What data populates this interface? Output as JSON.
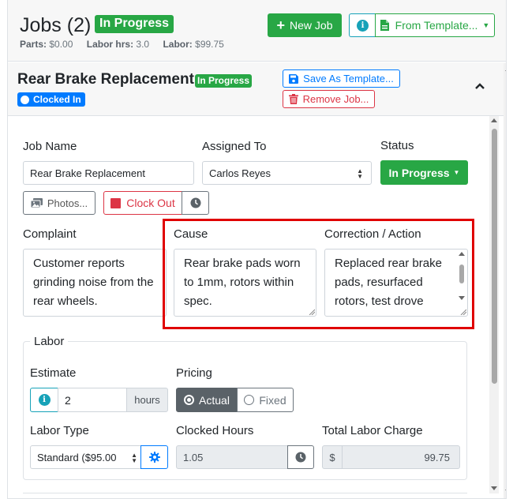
{
  "jobs_header": {
    "title": "Jobs (2)",
    "status_badge": "In Progress",
    "totals": [
      {
        "label": "Parts:",
        "value": "$0.00"
      },
      {
        "label": "Labor hrs:",
        "value": "3.0"
      },
      {
        "label": "Labor:",
        "value": "$99.75"
      }
    ],
    "new_job_label": "New Job",
    "from_template_label": "From Template..."
  },
  "job": {
    "title": "Rear Brake Replacement",
    "status_badge": "In Progress",
    "clocked_badge": "Clocked In",
    "save_template_label": "Save As Template...",
    "remove_job_label": "Remove Job..."
  },
  "form": {
    "job_name_label": "Job Name",
    "job_name_value": "Rear Brake Replacement",
    "assigned_to_label": "Assigned To",
    "assigned_to_value": "Carlos Reyes",
    "status_label": "Status",
    "status_value": "In Progress",
    "photos_label": "Photos...",
    "clock_out_label": "Clock Out",
    "complaint_label": "Complaint",
    "complaint_value": "Customer reports grinding noise from the rear wheels.",
    "cause_label": "Cause",
    "cause_value": "Rear brake pads worn to 1mm, rotors within spec.",
    "correction_label": "Correction / Action",
    "correction_value": "Replaced rear brake pads, resurfaced rotors, test drove"
  },
  "labor": {
    "legend": "Labor",
    "estimate_label": "Estimate",
    "estimate_value": "2",
    "estimate_unit": "hours",
    "pricing_label": "Pricing",
    "pricing_options": [
      "Actual",
      "Fixed"
    ],
    "pricing_selected": "Actual",
    "labor_type_label": "Labor Type",
    "labor_type_value": "Standard ($95.00",
    "clocked_hours_label": "Clocked Hours",
    "clocked_hours_value": "1.05",
    "total_charge_label": "Total Labor Charge",
    "total_charge_currency": "$",
    "total_charge_value": "99.75"
  },
  "colors": {
    "success": "#28a745",
    "primary": "#007bff",
    "danger": "#dc3545",
    "info": "#17a2b8",
    "highlight": "#e00000"
  }
}
